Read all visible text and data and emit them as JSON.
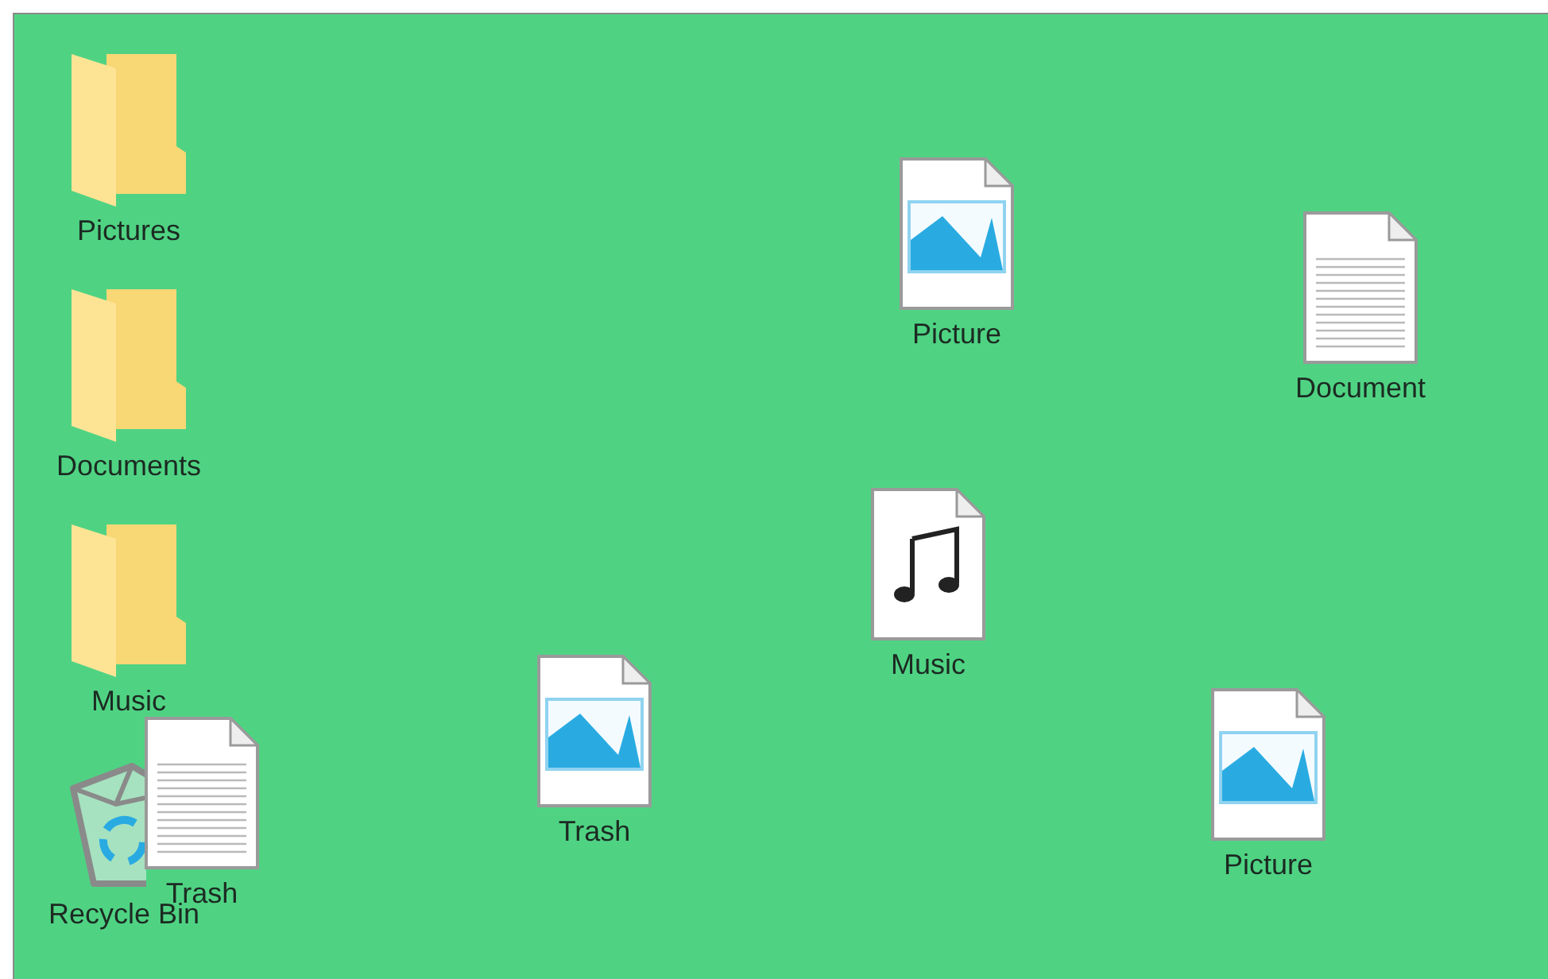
{
  "desktop": {
    "icons": [
      {
        "kind": "folder",
        "label": "Pictures"
      },
      {
        "kind": "folder",
        "label": "Documents"
      },
      {
        "kind": "folder",
        "label": "Music"
      },
      {
        "kind": "recycle-bin",
        "label": "Recycle Bin"
      },
      {
        "kind": "document",
        "label": "Trash"
      },
      {
        "kind": "picture",
        "label": "Picture"
      },
      {
        "kind": "document",
        "label": "Document"
      },
      {
        "kind": "music",
        "label": "Music"
      },
      {
        "kind": "picture",
        "label": "Trash"
      },
      {
        "kind": "picture",
        "label": "Picture"
      }
    ]
  }
}
